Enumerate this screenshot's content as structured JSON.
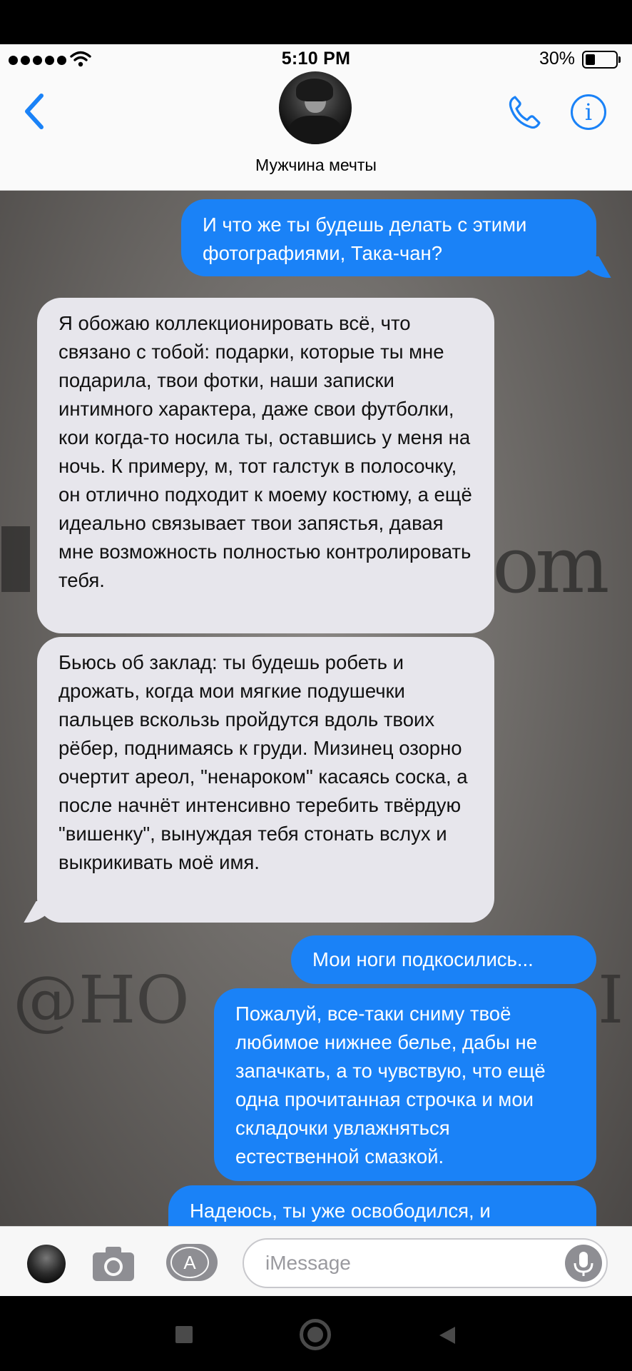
{
  "status_bar": {
    "time": "5:10 PM",
    "battery_percent": "30%",
    "battery_level": 0.3,
    "signal_bars": 5,
    "icons": [
      "signal-dots-icon",
      "wifi-icon",
      "battery-icon"
    ]
  },
  "header": {
    "contact_name": "Мужчина мечты",
    "info_glyph": "i",
    "icons": [
      "chevron-left-icon",
      "phone-icon",
      "info-icon"
    ],
    "accent_color": "#1a82f7"
  },
  "messages": [
    {
      "direction": "outgoing",
      "text": "И что же ты будешь делать с этими фотографиями, Така-чан?"
    },
    {
      "direction": "incoming",
      "text": "Я обожаю коллекционировать всё, что связано с тобой: подарки, которые ты мне подарила, твои фотки, наши записки интимного характера, даже свои футболки, кои когда-то носила ты, оставшись у меня на ночь. К примеру, м, тот галстук в полосочку, он отлично подходит к моему костюму, а ещё идеально связывает твои запястья, давая мне возможность полностью контролировать тебя."
    },
    {
      "direction": "incoming",
      "text": "Бьюсь об заклад: ты будешь робеть и дрожать, когда мои мягкие подушечки пальцев вскользь пройдутся вдоль твоих рёбер, поднимаясь к груди. Мизинец озорно очертит ареол, \"ненароком\" касаясь соска, а после начнёт интенсивно теребить твёрдую \"вишенку\", вынуждая тебя стонать вслух и выкрикивать моё имя."
    },
    {
      "direction": "outgoing",
      "text": "Мои ноги подкосились..."
    },
    {
      "direction": "outgoing",
      "text": "Пожалуй, все-таки сниму твоё любимое нижнее белье, дабы не запачкать, а то чувствую, что ещё одна прочитанная строчка и мои складочки увлажняться естественной смазкой."
    },
    {
      "direction": "outgoing",
      "text": "Надеюсь, ты уже освободился, и"
    }
  ],
  "watermark": {
    "line1_fragment": "om",
    "line2_left": "@HO",
    "line2_right": "I"
  },
  "composer": {
    "placeholder": "iMessage",
    "value": "",
    "apps_glyph": "A",
    "icons": [
      "avatar",
      "camera-icon",
      "app-store-icon",
      "microphone-icon"
    ]
  },
  "nav_bar": {
    "icons": [
      "recents-square-icon",
      "home-circle-icon",
      "back-triangle-icon"
    ]
  },
  "colors": {
    "outgoing_bubble": "#1a82f7",
    "incoming_bubble": "#e7e6ec",
    "header_bg": "#fafafa"
  }
}
